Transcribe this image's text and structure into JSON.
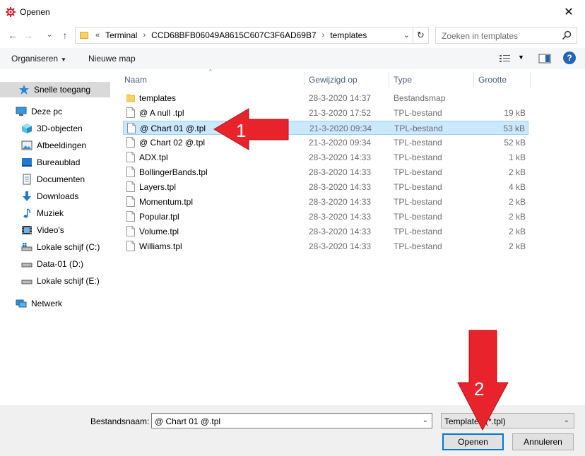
{
  "window": {
    "title": "Openen",
    "close_glyph": "✕",
    "icon": "app-logo-icon"
  },
  "address": {
    "back": "←",
    "forward": "→",
    "recent": "⌄",
    "up": "↑",
    "overflow": "«",
    "crumbs": [
      "Terminal",
      "CCD68BFB06049A8615C607C3F6AD69B7",
      "templates"
    ],
    "separator": "›",
    "dropdown": "⌄",
    "refresh": "↻"
  },
  "search": {
    "placeholder": "Zoeken in templates"
  },
  "toolbar": {
    "organize": "Organiseren",
    "organize_arrow": "▼",
    "new_folder": "Nieuwe map",
    "view_arrow": "▼",
    "help": "?"
  },
  "sidebar": {
    "items": [
      {
        "label": "Snelle toegang",
        "icon": "star-icon"
      },
      {
        "label": "Deze pc",
        "icon": "computer-icon"
      },
      {
        "label": "3D-objecten",
        "icon": "cube-icon"
      },
      {
        "label": "Afbeeldingen",
        "icon": "pictures-icon"
      },
      {
        "label": "Bureaublad",
        "icon": "desktop-icon"
      },
      {
        "label": "Documenten",
        "icon": "documents-icon"
      },
      {
        "label": "Downloads",
        "icon": "download-icon"
      },
      {
        "label": "Muziek",
        "icon": "music-icon"
      },
      {
        "label": "Video's",
        "icon": "video-icon"
      },
      {
        "label": "Lokale schijf (C:)",
        "icon": "drive-c-icon"
      },
      {
        "label": "Data-01 (D:)",
        "icon": "drive-icon"
      },
      {
        "label": "Lokale schijf (E:)",
        "icon": "drive-icon"
      },
      {
        "label": "Netwerk",
        "icon": "network-icon"
      }
    ]
  },
  "columns": {
    "name": "Naam",
    "modified": "Gewijzigd op",
    "type": "Type",
    "size": "Grootte",
    "sort_glyph": "^"
  },
  "files": [
    {
      "name": "templates",
      "date": "28-3-2020 14:37",
      "type": "Bestandsmap",
      "size": "",
      "kind": "folder"
    },
    {
      "name": "@ A null .tpl",
      "date": "21-3-2020 17:52",
      "type": "TPL-bestand",
      "size": "19 kB",
      "kind": "file"
    },
    {
      "name": "@ Chart 01 @.tpl",
      "date": "21-3-2020 09:34",
      "type": "TPL-bestand",
      "size": "53 kB",
      "kind": "file"
    },
    {
      "name": "@ Chart 02 @.tpl",
      "date": "21-3-2020 09:34",
      "type": "TPL-bestand",
      "size": "52 kB",
      "kind": "file"
    },
    {
      "name": "ADX.tpl",
      "date": "28-3-2020 14:33",
      "type": "TPL-bestand",
      "size": "1 kB",
      "kind": "file"
    },
    {
      "name": "BollingerBands.tpl",
      "date": "28-3-2020 14:33",
      "type": "TPL-bestand",
      "size": "2 kB",
      "kind": "file"
    },
    {
      "name": "Layers.tpl",
      "date": "28-3-2020 14:33",
      "type": "TPL-bestand",
      "size": "4 kB",
      "kind": "file"
    },
    {
      "name": "Momentum.tpl",
      "date": "28-3-2020 14:33",
      "type": "TPL-bestand",
      "size": "2 kB",
      "kind": "file"
    },
    {
      "name": "Popular.tpl",
      "date": "28-3-2020 14:33",
      "type": "TPL-bestand",
      "size": "2 kB",
      "kind": "file"
    },
    {
      "name": "Volume.tpl",
      "date": "28-3-2020 14:33",
      "type": "TPL-bestand",
      "size": "2 kB",
      "kind": "file"
    },
    {
      "name": "Williams.tpl",
      "date": "28-3-2020 14:33",
      "type": "TPL-bestand",
      "size": "2 kB",
      "kind": "file"
    }
  ],
  "selected_index": 2,
  "footer": {
    "filename_label": "Bestandsnaam:",
    "filename_value": "@ Chart 01 @.tpl",
    "filename_drop": "⌄",
    "filetype_value": "Templates (*.tpl)",
    "filetype_drop": "⌄",
    "open": "Openen",
    "cancel": "Annuleren"
  },
  "annotations": {
    "arrow1_label": "1",
    "arrow2_label": "2",
    "color": "#e8232b"
  }
}
